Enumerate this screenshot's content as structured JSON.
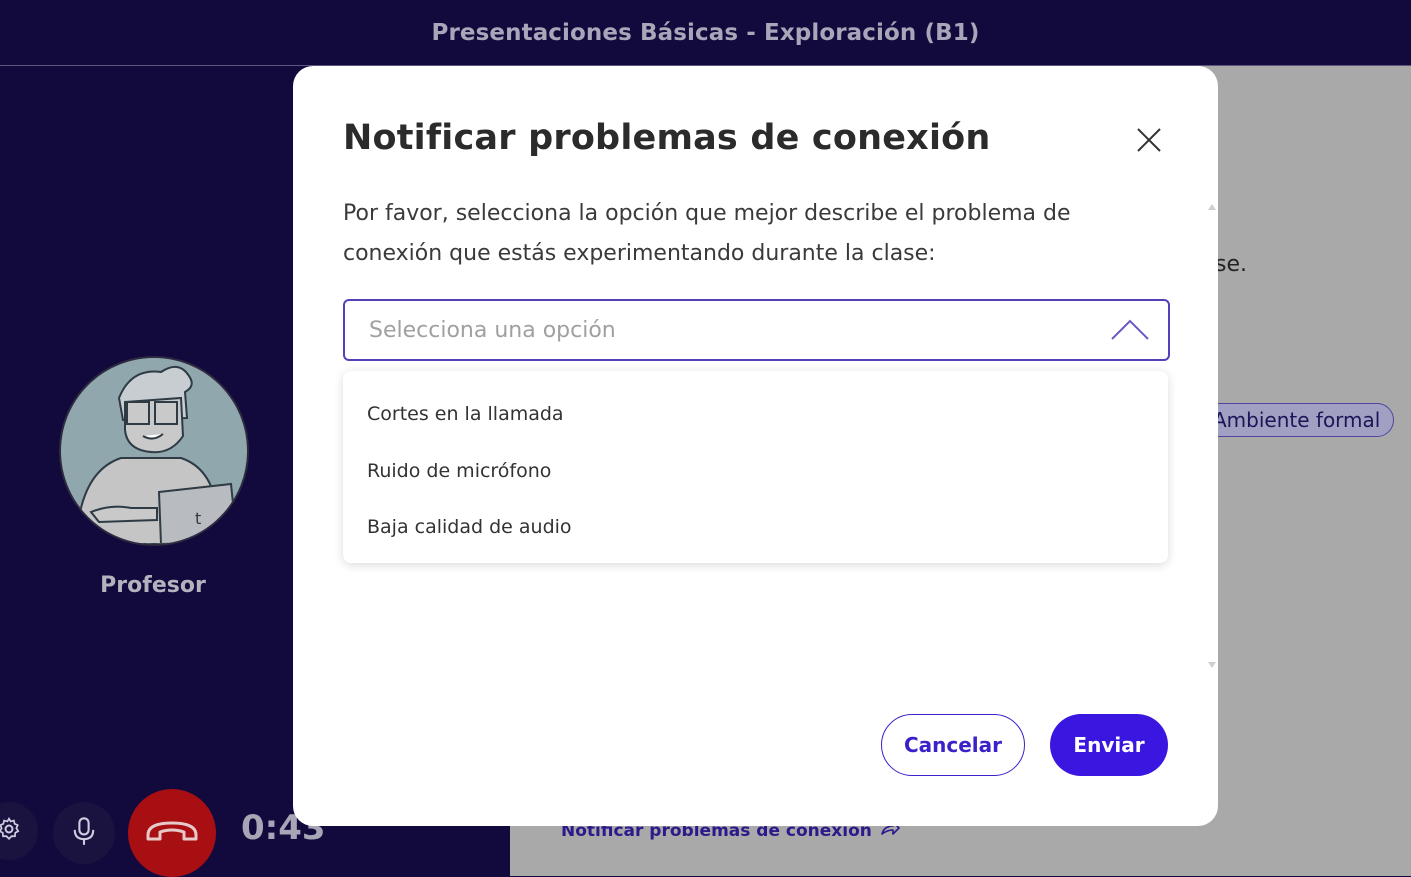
{
  "header": {
    "title": "Presentaciones Básicas - Exploración (B1)"
  },
  "call": {
    "teacher_name": "Profesor",
    "timer": "0:43",
    "controls": [
      "settings-icon",
      "microphone-icon",
      "hang-up-icon"
    ],
    "hangup_color": "#a80f13"
  },
  "background": {
    "partial_text": "se.",
    "chip_label": "Ambiente formal",
    "report_link_label": "Notificar problemas de conexión"
  },
  "modal": {
    "title": "Notificar problemas de conexión",
    "description": "Por favor, selecciona la opción que mejor describe el problema de conexión que estás experimentando durante la clase:",
    "select": {
      "placeholder": "Selecciona una opción",
      "options": [
        "Cortes en la llamada",
        "Ruido de micrófono",
        "Baja calidad de audio"
      ]
    },
    "cancel_label": "Cancelar",
    "send_label": "Enviar",
    "accent_color": "#3a16e0"
  }
}
